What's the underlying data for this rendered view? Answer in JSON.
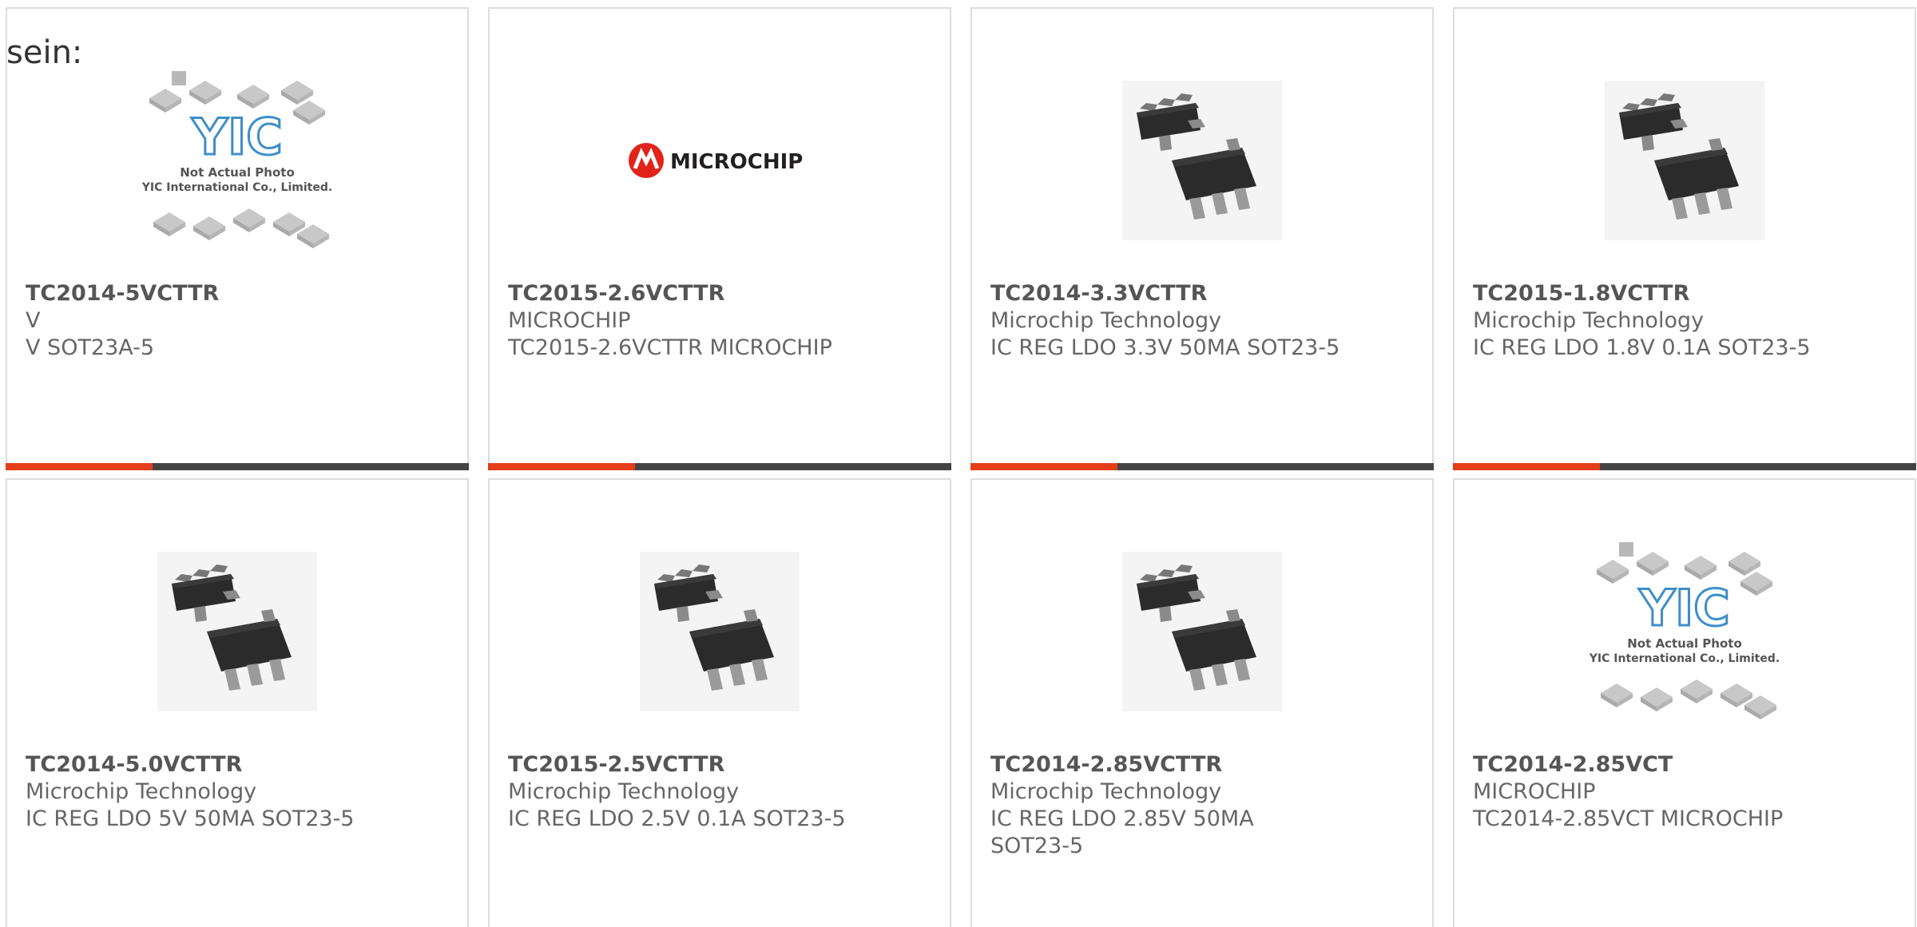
{
  "header": {
    "label": "sein:"
  },
  "colors": {
    "accent": "#e53e1a",
    "bar": "#444444",
    "border": "#dddddd",
    "text": "#666666"
  },
  "products": [
    {
      "image": "placeholder-photo",
      "part": "TC2014-5VCTTR",
      "manufacturer": "V",
      "description": "V SOT23A-5",
      "show_bar": true
    },
    {
      "image": "microchip-logo",
      "part": "TC2015-2.6VCTTR",
      "manufacturer": "MICROCHIP",
      "description": "TC2015-2.6VCTTR MICROCHIP",
      "show_bar": true
    },
    {
      "image": "sot23-5-package",
      "part": "TC2014-3.3VCTTR",
      "manufacturer": "Microchip Technology",
      "description": "IC REG LDO 3.3V 50MA SOT23-5",
      "show_bar": true
    },
    {
      "image": "sot23-5-package",
      "part": "TC2015-1.8VCTTR",
      "manufacturer": "Microchip Technology",
      "description": "IC REG LDO 1.8V 0.1A SOT23-5",
      "show_bar": true
    },
    {
      "image": "sot23-5-package",
      "part": "TC2014-5.0VCTTR",
      "manufacturer": "Microchip Technology",
      "description": "IC REG LDO 5V 50MA SOT23-5",
      "show_bar": false
    },
    {
      "image": "sot23-5-package",
      "part": "TC2015-2.5VCTTR",
      "manufacturer": "Microchip Technology",
      "description": "IC REG LDO 2.5V 0.1A SOT23-5",
      "show_bar": false
    },
    {
      "image": "sot23-5-package",
      "part": "TC2014-2.85VCTTR",
      "manufacturer": "Microchip Technology",
      "description": "IC REG LDO 2.85V 50MA SOT23-5",
      "show_bar": false
    },
    {
      "image": "placeholder-photo",
      "part": "TC2014-2.85VCT",
      "manufacturer": "MICROCHIP",
      "description": "TC2014-2.85VCT MICROCHIP",
      "show_bar": false
    }
  ],
  "placeholder": {
    "logo_text": "YIC",
    "line1": "Not Actual Photo",
    "line2": "YIC International Co., Limited."
  },
  "brand": {
    "name": "MICROCHIP"
  }
}
